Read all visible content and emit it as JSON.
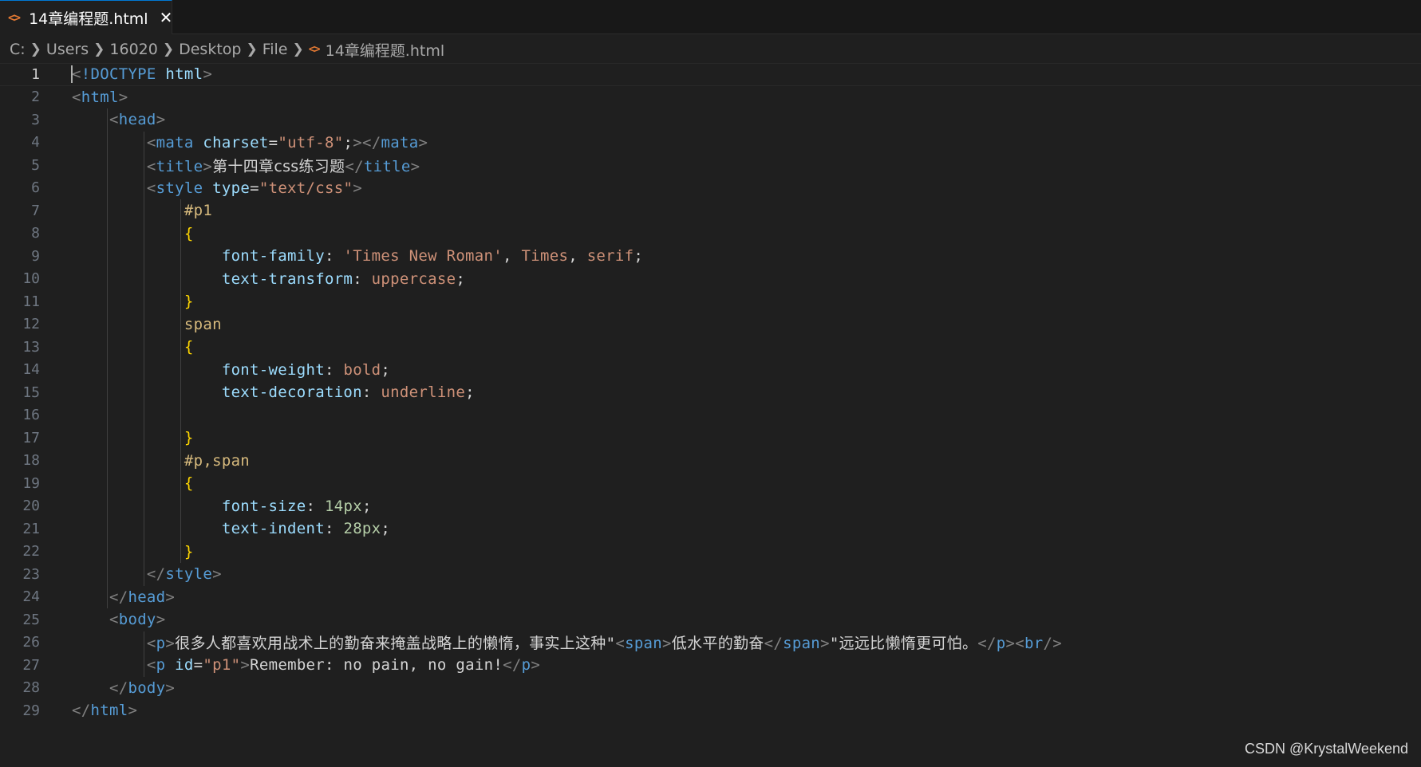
{
  "tab": {
    "icon": "html-file-icon",
    "label": "14章编程题.html",
    "close": "✕"
  },
  "breadcrumb": {
    "items": [
      "C:",
      "Users",
      "16020",
      "Desktop",
      "File"
    ],
    "file": "14章编程题.html"
  },
  "editor": {
    "current_line": 1,
    "line_numbers": [
      "1",
      "2",
      "3",
      "4",
      "5",
      "6",
      "7",
      "8",
      "9",
      "10",
      "11",
      "12",
      "13",
      "14",
      "15",
      "16",
      "17",
      "18",
      "19",
      "20",
      "21",
      "22",
      "23",
      "24",
      "25",
      "26",
      "27",
      "28",
      "29"
    ],
    "lines": [
      [
        [
          "p",
          "<"
        ],
        [
          "t",
          "!DOCTYPE"
        ],
        [
          "w",
          " "
        ],
        [
          "a",
          "html"
        ],
        [
          "p",
          ">"
        ]
      ],
      [
        [
          "p",
          "<"
        ],
        [
          "t",
          "html"
        ],
        [
          "p",
          ">"
        ]
      ],
      [
        [
          "w",
          "    "
        ],
        [
          "p",
          "<"
        ],
        [
          "t",
          "head"
        ],
        [
          "p",
          ">"
        ]
      ],
      [
        [
          "w",
          "        "
        ],
        [
          "p",
          "<"
        ],
        [
          "t",
          "mata"
        ],
        [
          "w",
          " "
        ],
        [
          "a",
          "charset"
        ],
        [
          "w",
          "="
        ],
        [
          "s",
          "\"utf-8\""
        ],
        [
          "w",
          ";"
        ],
        [
          "p",
          "></"
        ],
        [
          "t",
          "mata"
        ],
        [
          "p",
          ">"
        ]
      ],
      [
        [
          "w",
          "        "
        ],
        [
          "p",
          "<"
        ],
        [
          "t",
          "title"
        ],
        [
          "p",
          ">"
        ],
        [
          "cjk",
          "第十四章css练习题"
        ],
        [
          "p",
          "</"
        ],
        [
          "t",
          "title"
        ],
        [
          "p",
          ">"
        ]
      ],
      [
        [
          "w",
          "        "
        ],
        [
          "p",
          "<"
        ],
        [
          "t",
          "style"
        ],
        [
          "w",
          " "
        ],
        [
          "a",
          "type"
        ],
        [
          "w",
          "="
        ],
        [
          "s",
          "\"text/css\""
        ],
        [
          "p",
          ">"
        ]
      ],
      [
        [
          "w",
          "            "
        ],
        [
          "sel",
          "#p1"
        ]
      ],
      [
        [
          "w",
          "            "
        ],
        [
          "br",
          "{"
        ]
      ],
      [
        [
          "w",
          "                "
        ],
        [
          "a",
          "font-family"
        ],
        [
          "w",
          ": "
        ],
        [
          "s",
          "'Times New Roman'"
        ],
        [
          "w",
          ", "
        ],
        [
          "s",
          "Times"
        ],
        [
          "w",
          ", "
        ],
        [
          "s",
          "serif"
        ],
        [
          "w",
          ";"
        ]
      ],
      [
        [
          "w",
          "                "
        ],
        [
          "a",
          "text-transform"
        ],
        [
          "w",
          ": "
        ],
        [
          "s",
          "uppercase"
        ],
        [
          "w",
          ";"
        ]
      ],
      [
        [
          "w",
          "            "
        ],
        [
          "br",
          "}"
        ]
      ],
      [
        [
          "w",
          "            "
        ],
        [
          "sel",
          "span"
        ]
      ],
      [
        [
          "w",
          "            "
        ],
        [
          "br",
          "{"
        ]
      ],
      [
        [
          "w",
          "                "
        ],
        [
          "a",
          "font-weight"
        ],
        [
          "w",
          ": "
        ],
        [
          "s",
          "bold"
        ],
        [
          "w",
          ";"
        ]
      ],
      [
        [
          "w",
          "                "
        ],
        [
          "a",
          "text-decoration"
        ],
        [
          "w",
          ": "
        ],
        [
          "s",
          "underline"
        ],
        [
          "w",
          ";"
        ]
      ],
      [],
      [
        [
          "w",
          "            "
        ],
        [
          "br",
          "}"
        ]
      ],
      [
        [
          "w",
          "            "
        ],
        [
          "sel",
          "#p,span"
        ]
      ],
      [
        [
          "w",
          "            "
        ],
        [
          "br",
          "{"
        ]
      ],
      [
        [
          "w",
          "                "
        ],
        [
          "a",
          "font-size"
        ],
        [
          "w",
          ": "
        ],
        [
          "n",
          "14px"
        ],
        [
          "w",
          ";"
        ]
      ],
      [
        [
          "w",
          "                "
        ],
        [
          "a",
          "text-indent"
        ],
        [
          "w",
          ": "
        ],
        [
          "n",
          "28px"
        ],
        [
          "w",
          ";"
        ]
      ],
      [
        [
          "w",
          "            "
        ],
        [
          "br",
          "}"
        ]
      ],
      [
        [
          "w",
          "        "
        ],
        [
          "p",
          "</"
        ],
        [
          "t",
          "style"
        ],
        [
          "p",
          ">"
        ]
      ],
      [
        [
          "w",
          "    "
        ],
        [
          "p",
          "</"
        ],
        [
          "t",
          "head"
        ],
        [
          "p",
          ">"
        ]
      ],
      [
        [
          "w",
          "    "
        ],
        [
          "p",
          "<"
        ],
        [
          "t",
          "body"
        ],
        [
          "p",
          ">"
        ]
      ],
      [
        [
          "w",
          "        "
        ],
        [
          "p",
          "<"
        ],
        [
          "t",
          "p"
        ],
        [
          "p",
          ">"
        ],
        [
          "cjk",
          "很多人都喜欢用战术上的勤奋来掩盖战略上的懒惰，事实上这种"
        ],
        [
          "w",
          "\""
        ],
        [
          "p",
          "<"
        ],
        [
          "t",
          "span"
        ],
        [
          "p",
          ">"
        ],
        [
          "cjk",
          "低水平的勤奋"
        ],
        [
          "p",
          "</"
        ],
        [
          "t",
          "span"
        ],
        [
          "p",
          ">"
        ],
        [
          "w",
          "\""
        ],
        [
          "cjk",
          "远远比懒惰更可怕。"
        ],
        [
          "p",
          "</"
        ],
        [
          "t",
          "p"
        ],
        [
          "p",
          "><"
        ],
        [
          "t",
          "br"
        ],
        [
          "p",
          "/>"
        ]
      ],
      [
        [
          "w",
          "        "
        ],
        [
          "p",
          "<"
        ],
        [
          "t",
          "p"
        ],
        [
          "w",
          " "
        ],
        [
          "a",
          "id"
        ],
        [
          "w",
          "="
        ],
        [
          "s",
          "\"p1\""
        ],
        [
          "p",
          ">"
        ],
        [
          "w",
          "Remember: no pain, no gain!"
        ],
        [
          "p",
          "</"
        ],
        [
          "t",
          "p"
        ],
        [
          "p",
          ">"
        ]
      ],
      [
        [
          "w",
          "    "
        ],
        [
          "p",
          "</"
        ],
        [
          "t",
          "body"
        ],
        [
          "p",
          ">"
        ]
      ],
      [
        [
          "p",
          "</"
        ],
        [
          "t",
          "html"
        ],
        [
          "p",
          ">"
        ]
      ]
    ]
  },
  "watermark": "CSDN @KrystalWeekend"
}
